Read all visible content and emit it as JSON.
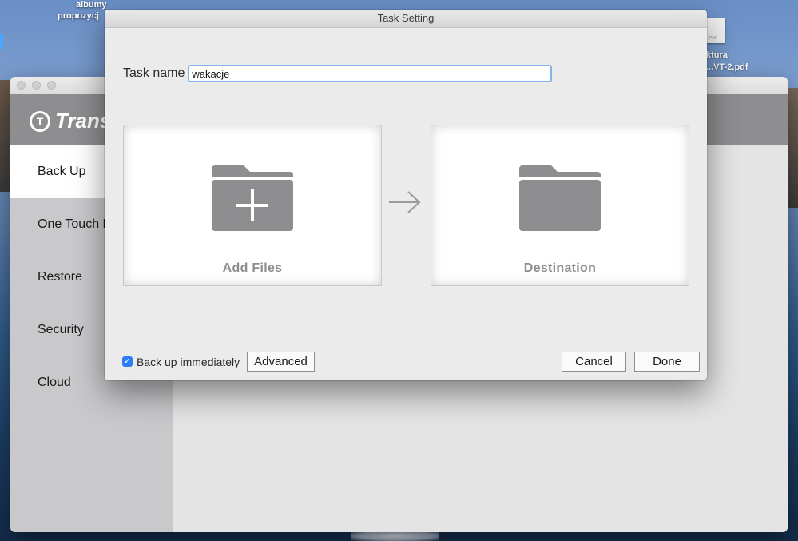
{
  "desktop": {
    "left_label_line1": "albumy",
    "left_label_line2": "propozycj",
    "right_label_line1": "ktura",
    "right_label_line2": "...VT-2.pdf",
    "pdf_badge": "PDF"
  },
  "app": {
    "brand": "Trans",
    "sidebar": {
      "items": [
        {
          "label": "Back Up",
          "active": true
        },
        {
          "label": "One Touch B"
        },
        {
          "label": "Restore"
        },
        {
          "label": "Security"
        },
        {
          "label": "Cloud"
        }
      ]
    }
  },
  "dialog": {
    "title": "Task Setting",
    "task_name_label": "Task name",
    "task_name_value": "wakacje",
    "source_panel_label": "Add Files",
    "destination_panel_label": "Destination",
    "backup_immediately_label": "Back up immediately",
    "backup_immediately_checked": true,
    "advanced_label": "Advanced",
    "cancel_label": "Cancel",
    "done_label": "Done"
  },
  "icons": {
    "source": "folder-add-icon",
    "destination": "folder-icon",
    "arrow": "arrow-right-icon",
    "checkbox": "checkmark-icon"
  },
  "colors": {
    "sidebar_bg": "#c9c9cc",
    "header_bg": "#8e8e90",
    "folder_gray": "#8e8e90",
    "checkbox_blue": "#2f7df6",
    "input_focus": "#82b3ea"
  }
}
